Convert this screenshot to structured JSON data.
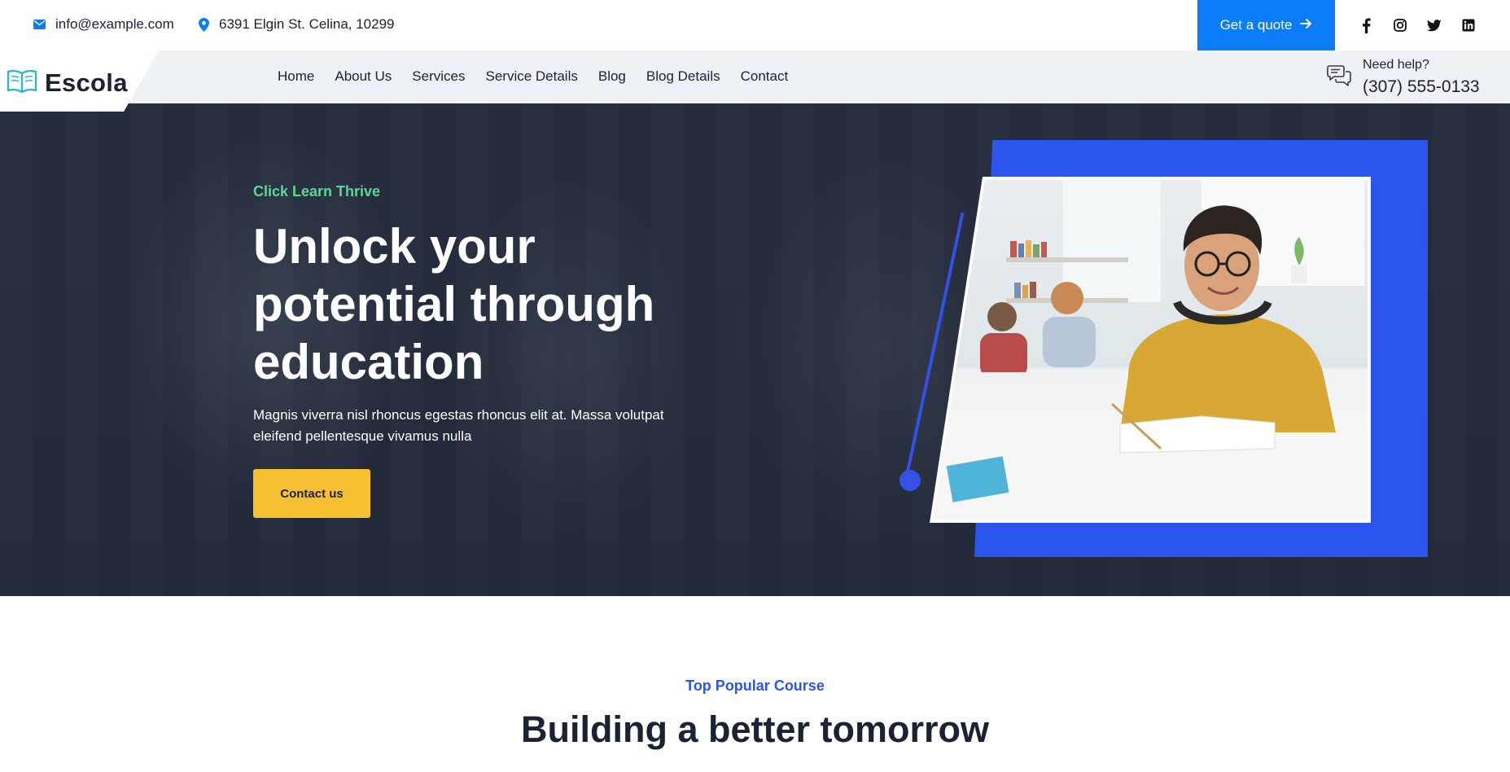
{
  "topbar": {
    "email": "info@example.com",
    "address": "6391 Elgin St. Celina, 10299",
    "quote_label": "Get a quote",
    "socials": [
      "facebook-icon",
      "instagram-icon",
      "twitter-icon",
      "linkedin-icon"
    ]
  },
  "nav": {
    "logo_text": "Escola",
    "links": [
      "Home",
      "About Us",
      "Services",
      "Service Details",
      "Blog",
      "Blog Details",
      "Contact"
    ],
    "help_label": "Need help?",
    "help_phone": "(307) 555-0133"
  },
  "hero": {
    "tagline": "Click Learn Thrive",
    "title": "Unlock your potential through education",
    "description": "Magnis viverra nisl rhoncus egestas rhoncus elit at. Massa volutpat eleifend pellentesque vivamus nulla",
    "cta_label": "Contact us"
  },
  "section": {
    "label": "Top Popular Course",
    "title": "Building a better tomorrow"
  },
  "colors": {
    "primary_blue": "#0b7cf8",
    "accent_blue": "#2c55ef",
    "green": "#5cd894",
    "yellow": "#f6c032",
    "dark": "#1b2233"
  }
}
